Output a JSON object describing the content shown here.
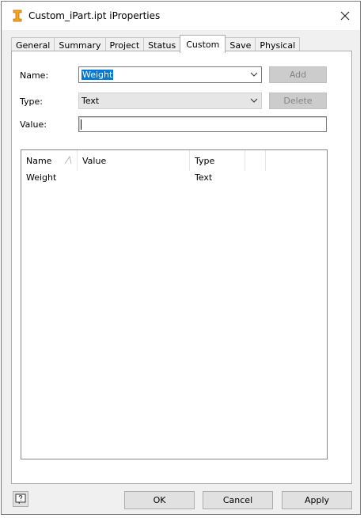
{
  "window": {
    "title": "Custom_iPart.ipt iProperties",
    "app_icon": "inventor-part-icon",
    "close_icon": "close-icon"
  },
  "tabs": [
    {
      "label": "General",
      "active": false
    },
    {
      "label": "Summary",
      "active": false
    },
    {
      "label": "Project",
      "active": false
    },
    {
      "label": "Status",
      "active": false
    },
    {
      "label": "Custom",
      "active": true
    },
    {
      "label": "Save",
      "active": false
    },
    {
      "label": "Physical",
      "active": false
    }
  ],
  "form": {
    "name_label": "Name:",
    "name_value": "Weight",
    "type_label": "Type:",
    "type_value": "Text",
    "value_label": "Value:",
    "value_value": "",
    "add_label": "Add",
    "delete_label": "Delete"
  },
  "table": {
    "columns": [
      "Name",
      "Value",
      "Type",
      ""
    ],
    "rows": [
      {
        "name": "Weight",
        "value": "",
        "type": "Text"
      }
    ]
  },
  "footer": {
    "ok_label": "OK",
    "cancel_label": "Cancel",
    "apply_label": "Apply",
    "help_icon": "help-icon"
  }
}
